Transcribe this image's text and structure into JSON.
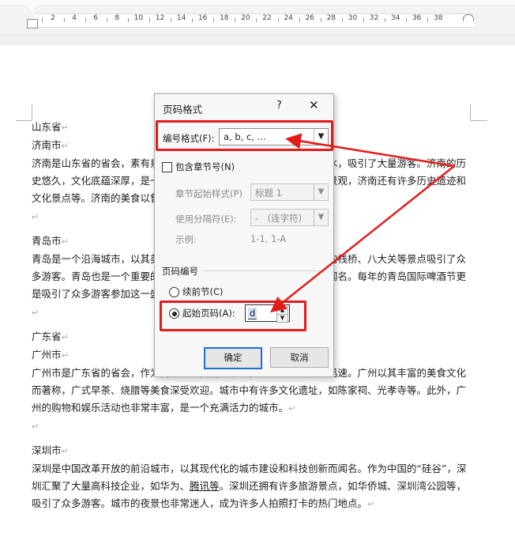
{
  "ruler": {
    "numbers": [
      "2",
      "4",
      "6",
      "8",
      "10",
      "12",
      "14",
      "16",
      "18",
      "20",
      "22",
      "24",
      "26",
      "28",
      "30",
      "32",
      "34",
      "36",
      "38"
    ]
  },
  "document": {
    "paragraphs": [
      "山东省",
      "济南市",
      "济南是山东省的省会，素有泉城之称，拥有趵突泉、黑虎泉等众多泉水，吸引了大量游客。济南的历史悠久，文化底蕴深厚，是一座有着深厚文化底蕴的城市。除了自然景观，济南还有许多历史遗迹和文化景点等。济南的美食以鲁菜为主，其中“济南把子肉”尤为出名。",
      "",
      "青岛市",
      "青岛是一个沿海城市，以其美丽的海滨风光和啤酒文化而闻名。青岛的栈桥、八大关等景点吸引了众多游客。青岛也是一个重要的经济中心，尤其以其海洋产业和旅游业闻名。每年的青岛国际啤酒节更是吸引了众多游客参加这一盛事。",
      "",
      "广东省",
      "广州市",
      "广州市是广东省的省会，作为南方的重要商业中心，广州的经济发展迅速。广州以其丰富的美食文化而著称，广式早茶、烧腊等美食深受欢迎。城市中有许多文化遗址，如陈家祠、光孝寺等。此外，广州的购物和娱乐活动也非常丰富，是一个充满活力的城市。",
      "",
      "深圳市"
    ],
    "last_para_before": "深圳是中国改革开放的前沿城市，以其现代化的城市建设和科技创新而闻名。作为中国的“硅谷”，深圳汇聚了大量高科技企业，如华为、",
    "last_para_link": "腾讯等",
    "last_para_after": "。深圳还拥有许多旅游景点，如华侨城、深圳湾公园等，吸引了众多游客。城市的夜景也非常迷人，成为许多人拍照打卡的热门地点。",
    "para_mark": "↵"
  },
  "dialog": {
    "title": "页码格式",
    "help": "?",
    "close": "✕",
    "number_format_label": "编号格式(F):",
    "number_format_value": "a, b, c, ...",
    "include_chapter_label": "包含章节号(N)",
    "chapter_start_style_label": "章节起始样式(P)",
    "chapter_start_style_value": "标题 1",
    "separator_label": "使用分隔符(E):",
    "separator_value": "-　(连字符)",
    "example_label": "示例:",
    "example_value": "1-1, 1-A",
    "page_numbering_label": "页码编号",
    "continue_label": "续前节(C)",
    "start_at_label": "起始页码(A):",
    "start_at_value": "d",
    "ok": "确定",
    "cancel": "取消"
  },
  "colors": {
    "highlight": "#e41b1b",
    "default_button": "#1f6fd1"
  }
}
